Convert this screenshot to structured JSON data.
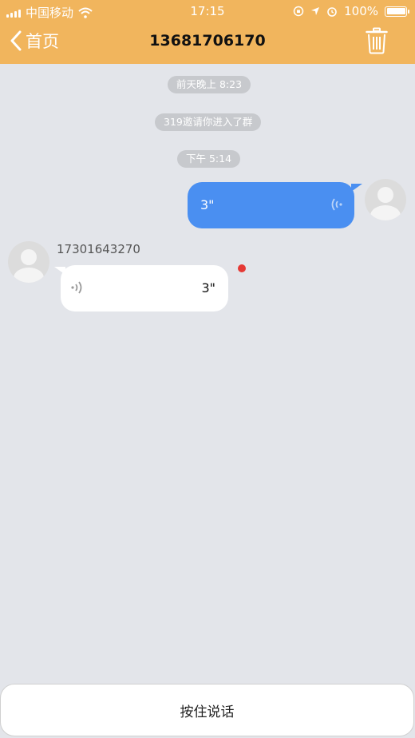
{
  "status_bar": {
    "carrier": "中国移动",
    "time": "17:15",
    "battery_percent": "100%"
  },
  "nav": {
    "back_label": "首页",
    "title": "13681706170",
    "delete_icon": "trash-icon"
  },
  "messages": {
    "timestamp_1": "前天晚上 8:23",
    "system_notice": "319邀请你进入了群",
    "timestamp_2": "下午 5:14",
    "outgoing_voice": {
      "duration": "3\"",
      "icon": "voice-wave-icon"
    },
    "incoming_voice": {
      "sender": "17301643270",
      "duration": "3\"",
      "icon": "voice-wave-icon",
      "unread": true
    }
  },
  "footer": {
    "hold_to_talk_label": "按住说话"
  },
  "colors": {
    "header": "#f1b55d",
    "background": "#e3e5ea",
    "outgoing_bubble": "#4a8ff1",
    "incoming_bubble": "#ffffff",
    "unread_dot": "#e53935"
  }
}
